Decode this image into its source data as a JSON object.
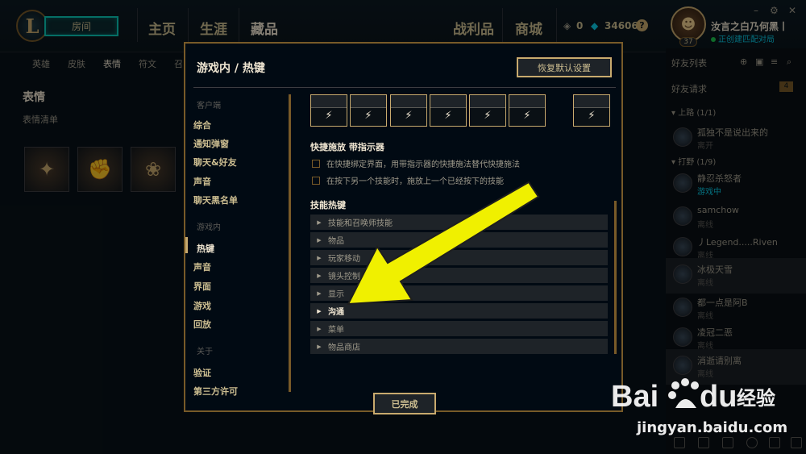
{
  "topbar": {
    "room_label": "房间",
    "nav": [
      "主页",
      "生涯",
      "藏品",
      "战利品",
      "商城"
    ],
    "blue_essence": "0",
    "riot_points": "34606",
    "help": "?",
    "window_controls": [
      "–",
      "⚙",
      "✕"
    ]
  },
  "profile": {
    "name": "汝言之白乃何黑丨",
    "status": "正创建匹配对局",
    "level": "37"
  },
  "subnav": [
    "英雄",
    "皮肤",
    "表情",
    "符文",
    "召"
  ],
  "collection": {
    "title": "表情",
    "subtitle": "表情清单"
  },
  "friends": {
    "list_label": "好友列表",
    "requests_label": "好友请求",
    "requests_count": "4",
    "groups": [
      {
        "name": "上路 (1/1)"
      },
      {
        "name": "打野 (1/9)"
      }
    ],
    "items": [
      {
        "name": "孤独不是说出来的",
        "status": "离开",
        "ingame": false
      },
      {
        "name": "静忍杀怒者",
        "status": "游戏中",
        "ingame": true
      },
      {
        "name": "samchow",
        "status": "离线",
        "ingame": false
      },
      {
        "name": "丿Legend.....Riven",
        "status": "离线",
        "ingame": false
      },
      {
        "name": "冰极天雪",
        "status": "离线",
        "ingame": false
      },
      {
        "name": "都一点是阿B",
        "status": "离线",
        "ingame": false
      },
      {
        "name": "凌冠二恶",
        "status": "离线",
        "ingame": false
      },
      {
        "name": "消逝请别离",
        "status": "离线",
        "ingame": false
      }
    ]
  },
  "modal": {
    "title": "游戏内 / 热键",
    "restore_button": "恢复默认设置",
    "done_button": "已完成",
    "sidebar": {
      "client_header": "客户端",
      "client_items": [
        "综合",
        "通知弹窗",
        "聊天&好友",
        "声音",
        "聊天黑名单"
      ],
      "ingame_header": "游戏内",
      "ingame_items": [
        "热键",
        "声音",
        "界面",
        "游戏",
        "回放"
      ],
      "about_header": "关于",
      "about_items": [
        "验证",
        "第三方许可"
      ]
    },
    "quickcast": {
      "title": "快捷施放 带指示器",
      "options": [
        "在快捷绑定界面，用带指示器的快捷施法替代快捷施法",
        "在按下另一个技能时，施放上一个已经按下的技能"
      ]
    },
    "hotkeys": {
      "title": "技能热键",
      "sections": [
        "技能和召唤师技能",
        "物品",
        "玩家移动",
        "镜头控制",
        "显示",
        "沟通",
        "菜单",
        "物品商店"
      ],
      "highlighted": "沟通"
    }
  },
  "watermark": {
    "logo_text": "Bai",
    "logo_text2": "du",
    "logo_cn": "经验",
    "url": "jingyan.baidu.com"
  }
}
